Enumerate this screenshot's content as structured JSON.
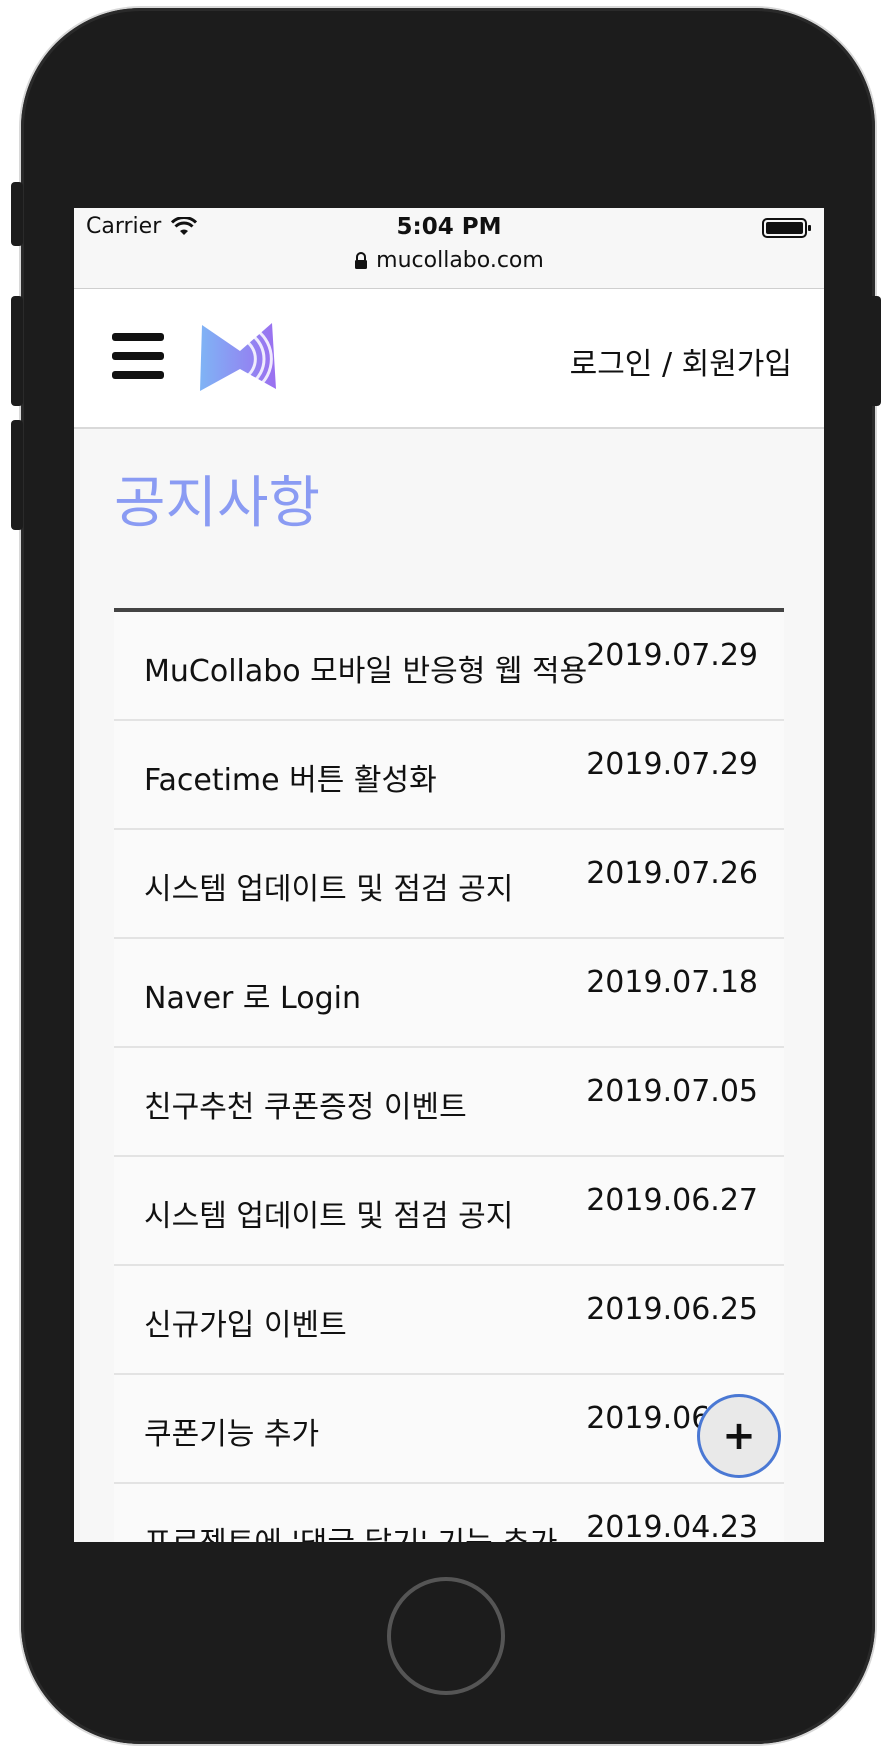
{
  "status_bar": {
    "carrier": "Carrier",
    "time": "5:04 PM",
    "url": "mucollabo.com"
  },
  "header": {
    "login_label": "로그인 / 회원가입",
    "menu_icon": "hamburger-icon",
    "logo_icon": "mucollabo-logo"
  },
  "page": {
    "title": "공지사항"
  },
  "notices": [
    {
      "title": "MuCollabo 모바일 반응형 웹 적용",
      "date": "2019.07.29"
    },
    {
      "title": "Facetime 버튼 활성화",
      "date": "2019.07.29"
    },
    {
      "title": "시스템 업데이트 및 점검 공지",
      "date": "2019.07.26"
    },
    {
      "title": "Naver 로 Login",
      "date": "2019.07.18"
    },
    {
      "title": "친구추천 쿠폰증정 이벤트",
      "date": "2019.07.05"
    },
    {
      "title": "시스템 업데이트 및 점검 공지",
      "date": "2019.06.27"
    },
    {
      "title": "신규가입 이벤트",
      "date": "2019.06.25"
    },
    {
      "title": "쿠폰기능 추가",
      "date": "2019.06.25"
    },
    {
      "title": "프로젝트에 '댓글 달기' 기능 추가",
      "date": "2019.04.23"
    }
  ],
  "fab": {
    "label": "+",
    "icon": "plus-icon"
  },
  "colors": {
    "title": "#8a9bf3",
    "fab_border": "#4a78d4"
  }
}
